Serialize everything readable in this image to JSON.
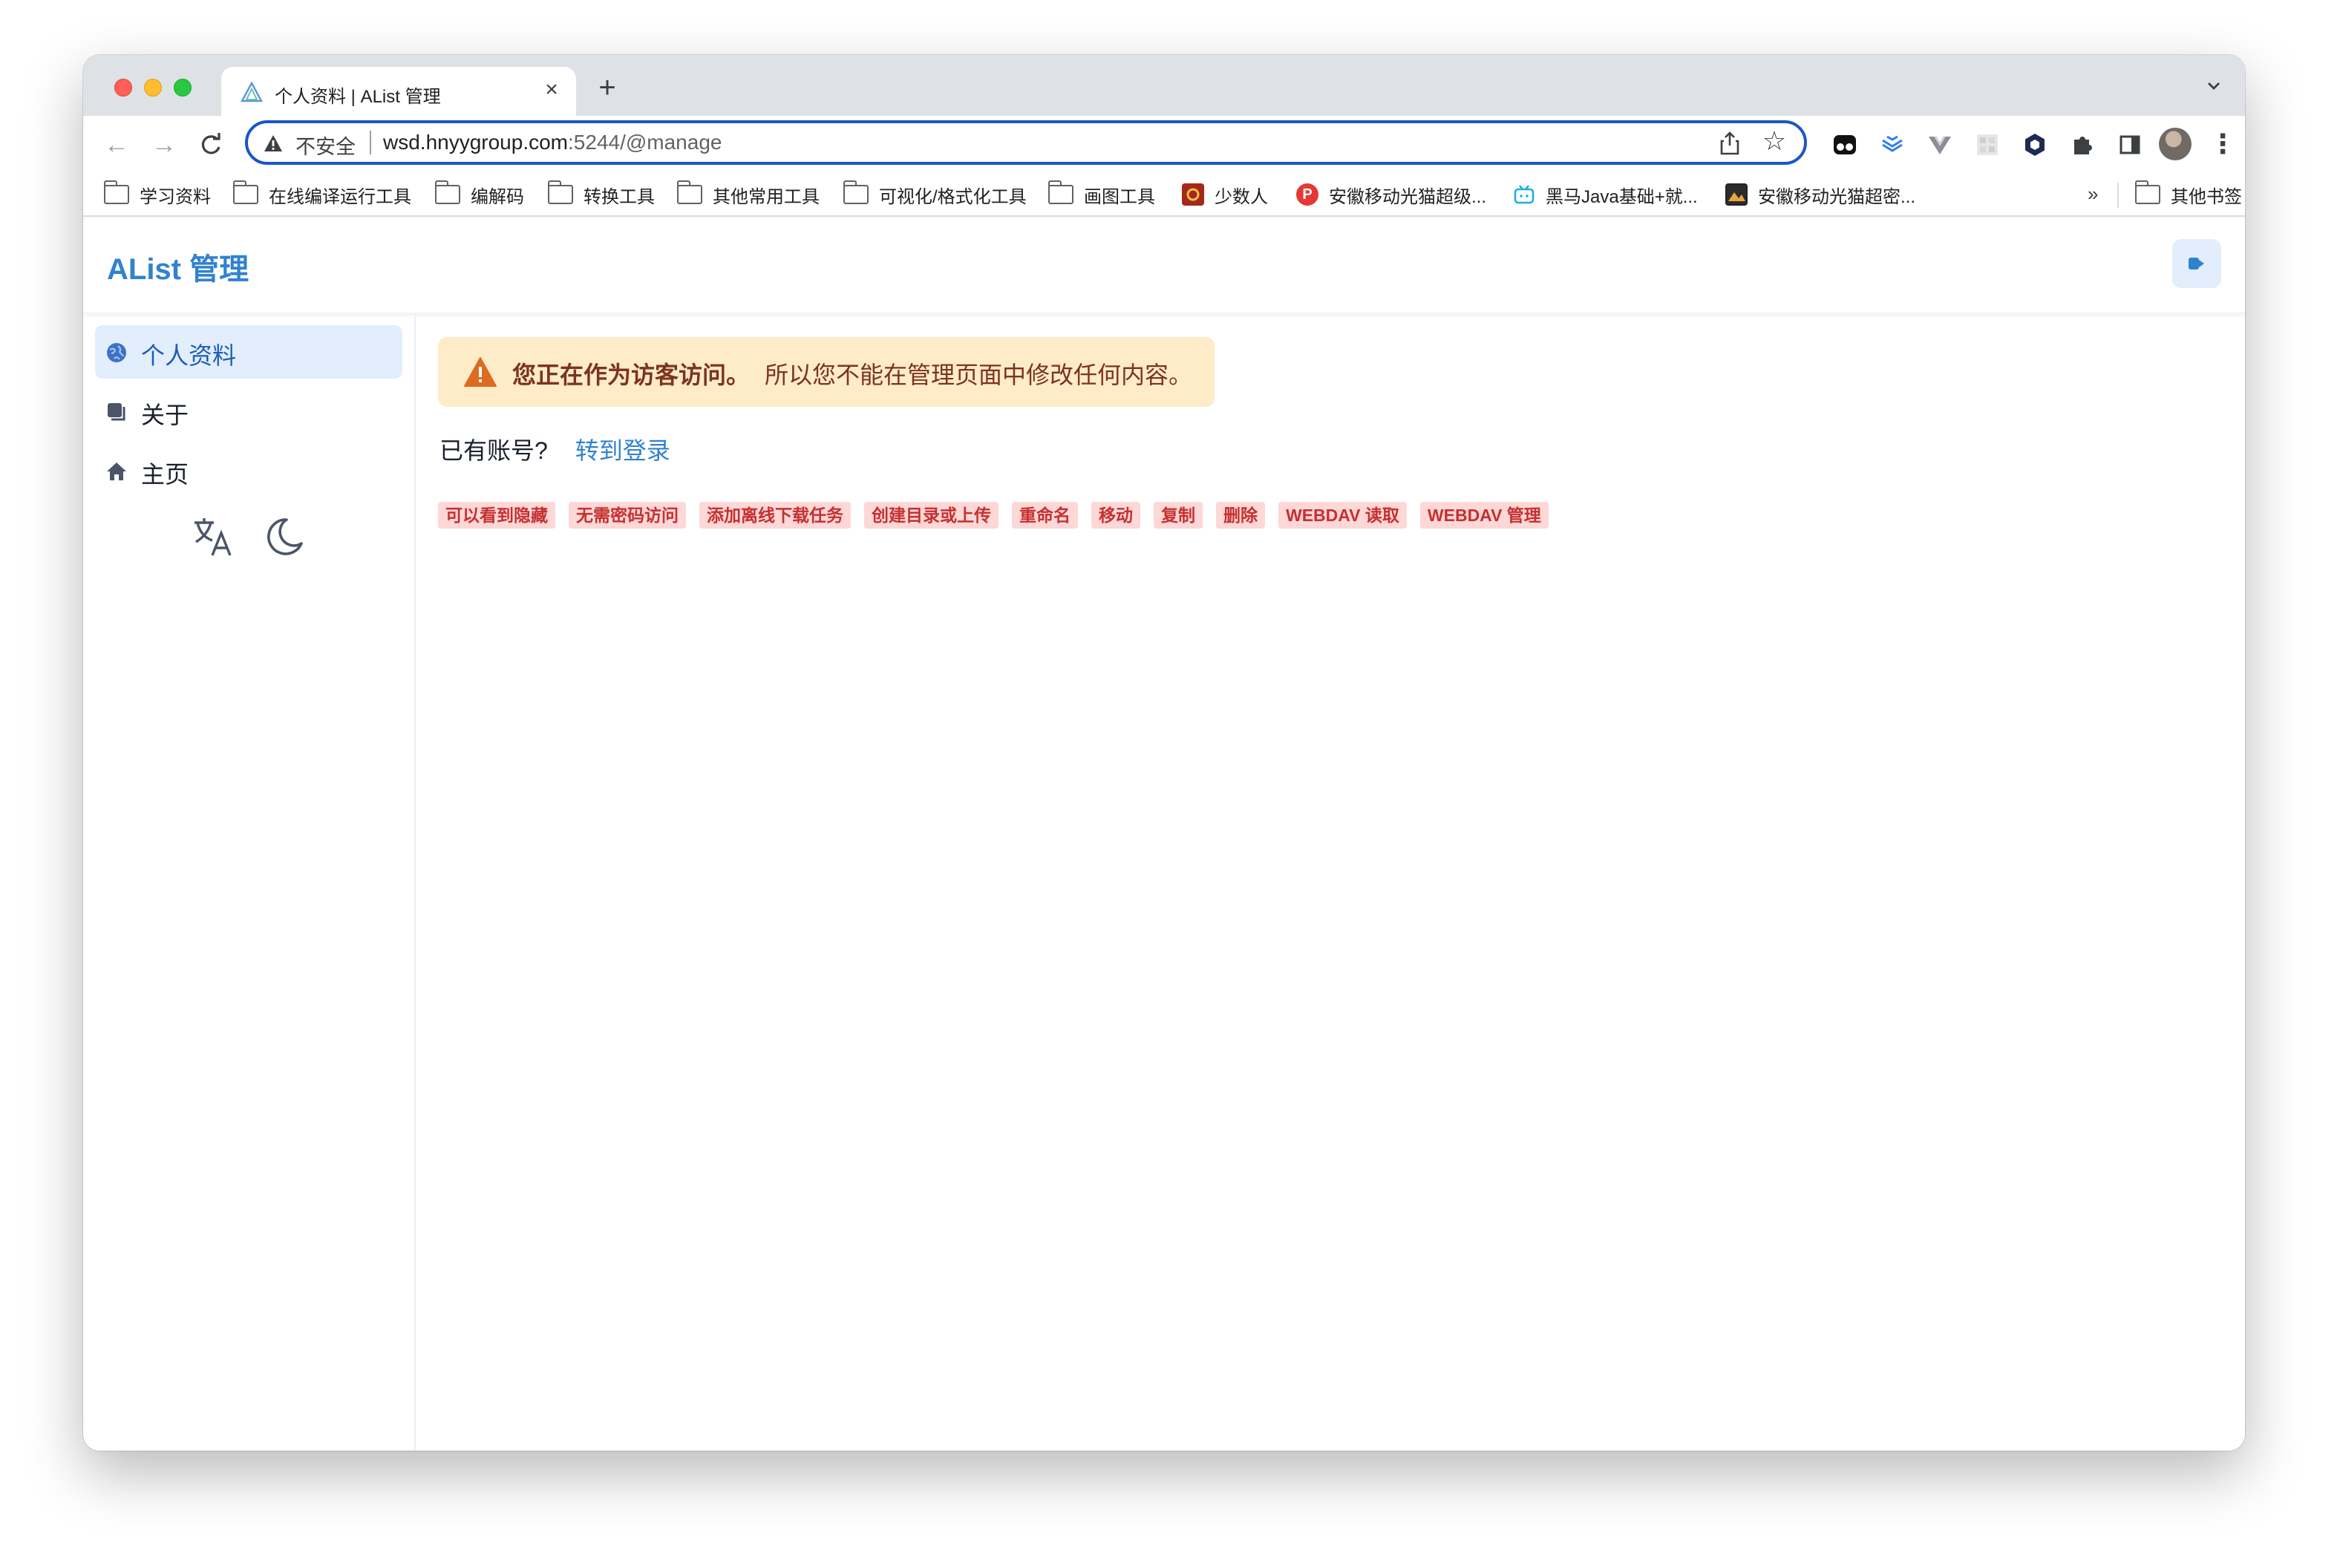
{
  "browser": {
    "tab": {
      "title": "个人资料 | AList 管理",
      "close": "×"
    },
    "new_tab": "+",
    "omnibox": {
      "security": "不安全",
      "url_host": "wsd.hnyygroup.com",
      "url_rest": ":5244/@manage"
    },
    "bookmarks": [
      {
        "label": "学习资料",
        "icon": "folder-icon"
      },
      {
        "label": "在线编译运行工具",
        "icon": "folder-icon"
      },
      {
        "label": "编解码",
        "icon": "folder-icon"
      },
      {
        "label": "转换工具",
        "icon": "folder-icon"
      },
      {
        "label": "其他常用工具",
        "icon": "folder-icon"
      },
      {
        "label": "可视化/格式化工具",
        "icon": "folder-icon"
      },
      {
        "label": "画图工具",
        "icon": "folder-icon"
      },
      {
        "label": "少数人",
        "icon": "favicon-shaoshuren"
      },
      {
        "label": "安徽移动光猫超级...",
        "icon": "favicon-p",
        "glyph": "P"
      },
      {
        "label": "黑马Java基础+就...",
        "icon": "favicon-bilibili"
      },
      {
        "label": "安徽移动光猫超密...",
        "icon": "favicon-image"
      }
    ],
    "bookmarks_more": "»",
    "other_bookmarks": "其他书签"
  },
  "app": {
    "title": "AList 管理",
    "sidebar": {
      "items": [
        {
          "label": "个人资料",
          "icon": "user-globe-icon",
          "active": true
        },
        {
          "label": "关于",
          "icon": "copy-icon",
          "active": false
        },
        {
          "label": "主页",
          "icon": "home-icon",
          "active": false
        }
      ]
    },
    "alert": {
      "title": "您正在作为访客访问。",
      "description": "所以您不能在管理页面中修改任何内容。"
    },
    "account": {
      "question": "已有账号?",
      "login_link": "转到登录"
    },
    "permissions": [
      "可以看到隐藏",
      "无需密码访问",
      "添加离线下载任务",
      "创建目录或上传",
      "重命名",
      "移动",
      "复制",
      "删除",
      "WEBDAV 读取",
      "WEBDAV 管理"
    ]
  },
  "colors": {
    "accent": "#3182ce",
    "alert_bg": "#feebc8",
    "alert_icon": "#dd6b20",
    "badge_bg": "#fed7d7",
    "badge_text": "#c53030"
  }
}
